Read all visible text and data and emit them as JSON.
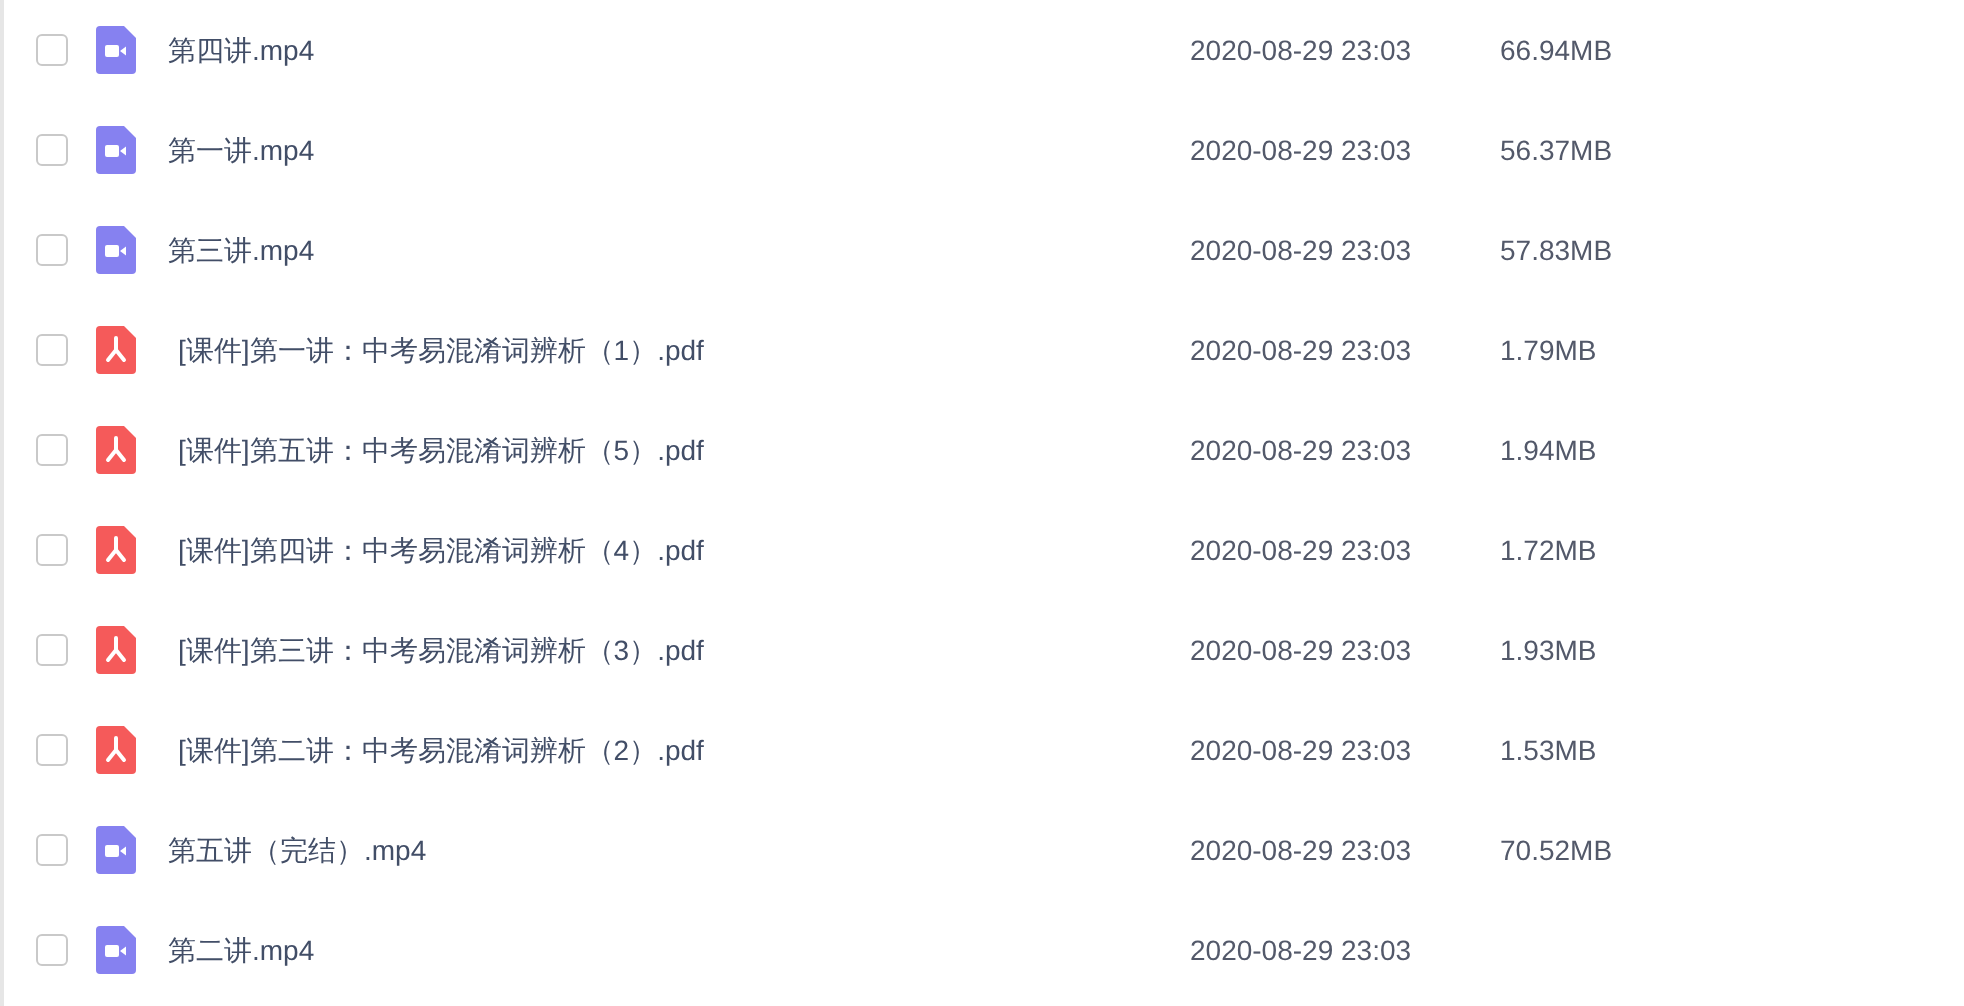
{
  "files": [
    {
      "kind": "video",
      "name": "第四讲.mp4",
      "checked": false,
      "date": "2020-08-29 23:03",
      "size": "66.94MB"
    },
    {
      "kind": "video",
      "name": "第一讲.mp4",
      "checked": false,
      "date": "2020-08-29 23:03",
      "size": "56.37MB"
    },
    {
      "kind": "video",
      "name": "第三讲.mp4",
      "checked": false,
      "date": "2020-08-29 23:03",
      "size": "57.83MB"
    },
    {
      "kind": "pdf",
      "name": "[课件]第一讲：中考易混淆词辨析（1）.pdf",
      "checked": false,
      "date": "2020-08-29 23:03",
      "size": "1.79MB"
    },
    {
      "kind": "pdf",
      "name": "[课件]第五讲：中考易混淆词辨析（5）.pdf",
      "checked": false,
      "date": "2020-08-29 23:03",
      "size": "1.94MB"
    },
    {
      "kind": "pdf",
      "name": "[课件]第四讲：中考易混淆词辨析（4）.pdf",
      "checked": false,
      "date": "2020-08-29 23:03",
      "size": "1.72MB"
    },
    {
      "kind": "pdf",
      "name": "[课件]第三讲：中考易混淆词辨析（3）.pdf",
      "checked": false,
      "date": "2020-08-29 23:03",
      "size": "1.93MB"
    },
    {
      "kind": "pdf",
      "name": "[课件]第二讲：中考易混淆词辨析（2）.pdf",
      "checked": false,
      "date": "2020-08-29 23:03",
      "size": "1.53MB"
    },
    {
      "kind": "video",
      "name": "第五讲（完结）.mp4",
      "checked": false,
      "date": "2020-08-29 23:03",
      "size": "70.52MB"
    },
    {
      "kind": "video",
      "name": "第二讲.mp4",
      "checked": false,
      "date": "2020-08-29 23:03"
    }
  ]
}
